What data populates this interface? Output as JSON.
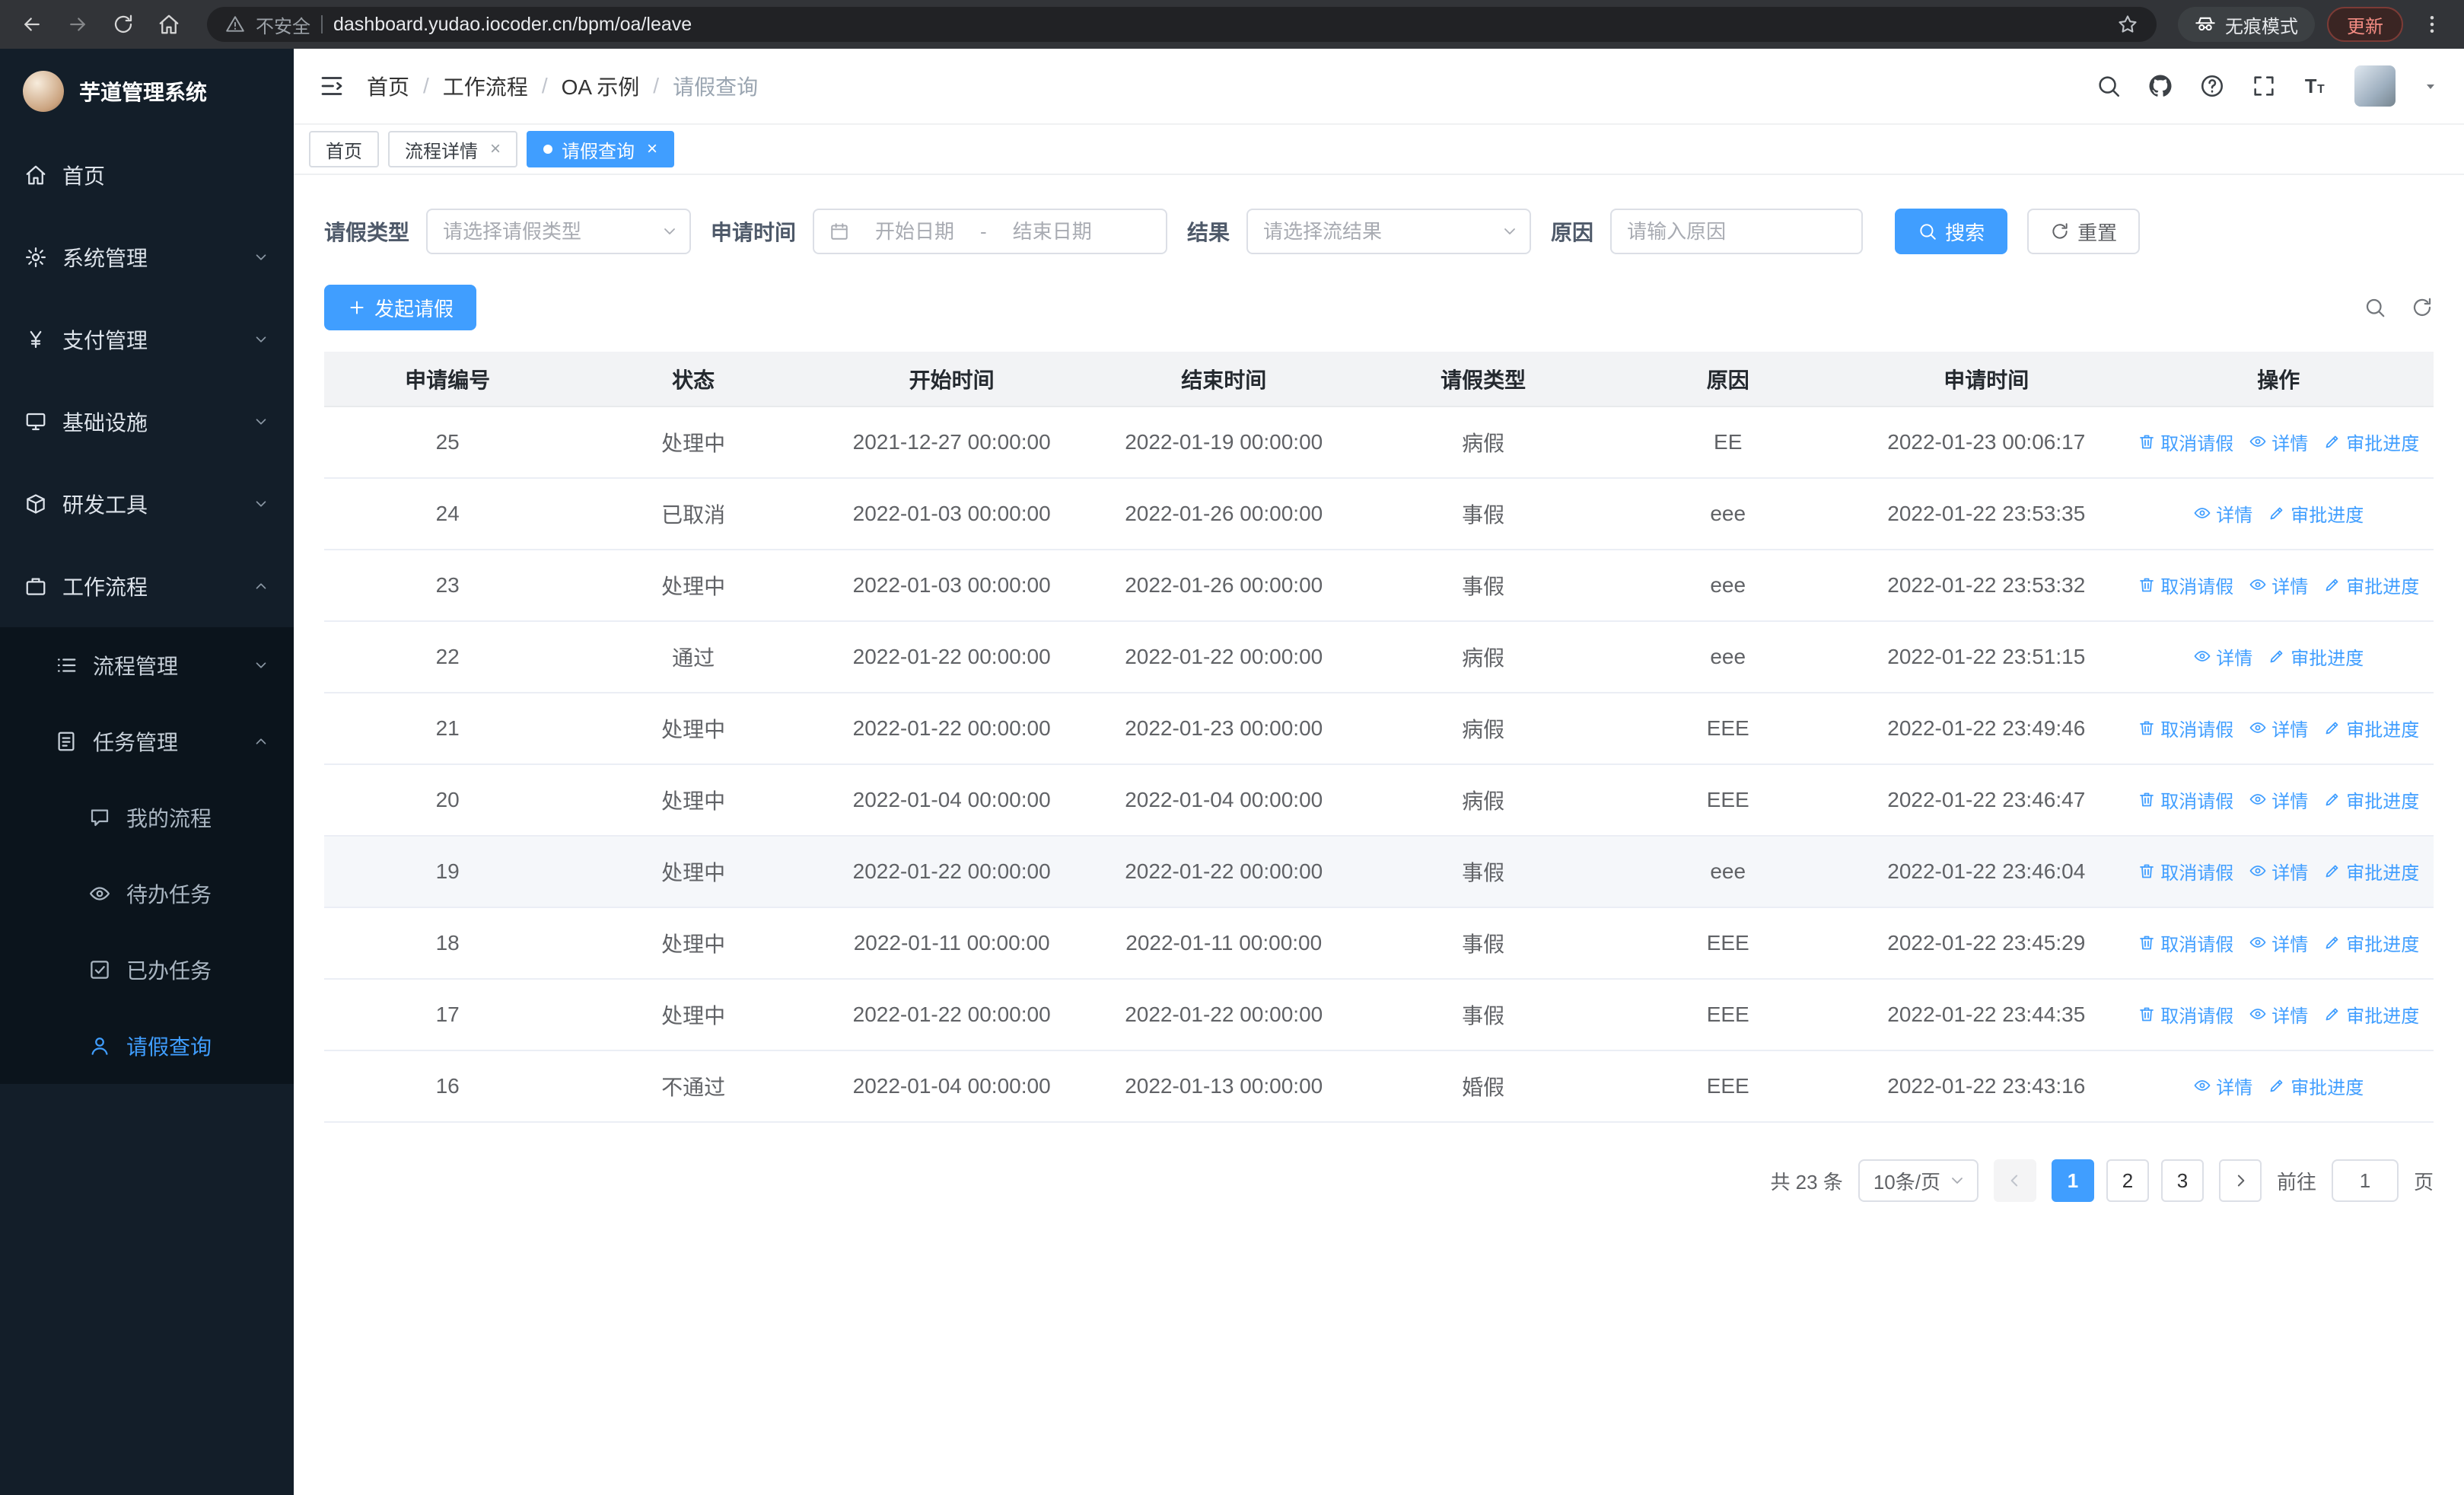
{
  "colors": {
    "primary": "#409eff",
    "sidebar_bg": "#131e29",
    "submenu_bg": "#0b141c"
  },
  "browser": {
    "security_warning": "不安全",
    "url": "dashboard.yudao.iocoder.cn/bpm/oa/leave",
    "incognito_label": "无痕模式",
    "update_button": "更新"
  },
  "sidebar": {
    "logo_title": "芋道管理系统",
    "items": [
      {
        "key": "home",
        "label": "首页",
        "icon": "home-icon",
        "level": 1
      },
      {
        "key": "system",
        "label": "系统管理",
        "icon": "gear-icon",
        "level": 1,
        "chevron": "down"
      },
      {
        "key": "payment",
        "label": "支付管理",
        "icon": "payment-icon",
        "level": 1,
        "chevron": "down"
      },
      {
        "key": "infrastructure",
        "label": "基础设施",
        "icon": "infra-icon",
        "level": 1,
        "chevron": "down"
      },
      {
        "key": "devtools",
        "label": "研发工具",
        "icon": "tools-icon",
        "level": 1,
        "chevron": "down"
      },
      {
        "key": "workflow",
        "label": "工作流程",
        "icon": "workflow-icon",
        "level": 1,
        "chevron": "up"
      }
    ],
    "submenu": [
      {
        "key": "process-management",
        "label": "流程管理",
        "icon": "process-icon",
        "level": 2,
        "chevron": "down"
      },
      {
        "key": "task-management",
        "label": "任务管理",
        "icon": "task-icon",
        "level": 2,
        "chevron": "up"
      },
      {
        "key": "my-process",
        "label": "我的流程",
        "icon": "my-process-icon",
        "level": 3
      },
      {
        "key": "todo-tasks",
        "label": "待办任务",
        "icon": "todo-icon",
        "level": 3
      },
      {
        "key": "done-tasks",
        "label": "已办任务",
        "icon": "done-icon",
        "level": 3
      },
      {
        "key": "leave-query",
        "label": "请假查询",
        "icon": "leave-icon",
        "level": 3,
        "active": true
      }
    ]
  },
  "header": {
    "breadcrumb": [
      "首页",
      "工作流程",
      "OA 示例",
      "请假查询"
    ]
  },
  "tabs": [
    {
      "label": "首页",
      "closable": false,
      "active": false
    },
    {
      "label": "流程详情",
      "closable": true,
      "active": false
    },
    {
      "label": "请假查询",
      "closable": true,
      "active": true
    }
  ],
  "filters": {
    "leave_type": {
      "label": "请假类型",
      "placeholder": "请选择请假类型"
    },
    "apply_time": {
      "label": "申请时间",
      "start_placeholder": "开始日期",
      "separator": "-",
      "end_placeholder": "结束日期"
    },
    "result": {
      "label": "结果",
      "placeholder": "请选择流结果"
    },
    "reason": {
      "label": "原因",
      "placeholder": "请输入原因"
    },
    "search_button": "搜索",
    "reset_button": "重置"
  },
  "toolbar": {
    "create_button": "发起请假"
  },
  "table": {
    "columns": [
      "申请编号",
      "状态",
      "开始时间",
      "结束时间",
      "请假类型",
      "原因",
      "申请时间",
      "操作"
    ],
    "action_labels": {
      "cancel": "取消请假",
      "detail": "详情",
      "progress": "审批进度"
    },
    "rows": [
      {
        "id": "25",
        "status": "处理中",
        "start": "2021-12-27 00:00:00",
        "end": "2022-01-19 00:00:00",
        "type": "病假",
        "reason": "EE",
        "applied": "2022-01-23 00:06:17",
        "actions": [
          "cancel",
          "detail",
          "progress"
        ]
      },
      {
        "id": "24",
        "status": "已取消",
        "start": "2022-01-03 00:00:00",
        "end": "2022-01-26 00:00:00",
        "type": "事假",
        "reason": "eee",
        "applied": "2022-01-22 23:53:35",
        "actions": [
          "detail",
          "progress"
        ]
      },
      {
        "id": "23",
        "status": "处理中",
        "start": "2022-01-03 00:00:00",
        "end": "2022-01-26 00:00:00",
        "type": "事假",
        "reason": "eee",
        "applied": "2022-01-22 23:53:32",
        "actions": [
          "cancel",
          "detail",
          "progress"
        ]
      },
      {
        "id": "22",
        "status": "通过",
        "start": "2022-01-22 00:00:00",
        "end": "2022-01-22 00:00:00",
        "type": "病假",
        "reason": "eee",
        "applied": "2022-01-22 23:51:15",
        "actions": [
          "detail",
          "progress"
        ]
      },
      {
        "id": "21",
        "status": "处理中",
        "start": "2022-01-22 00:00:00",
        "end": "2022-01-23 00:00:00",
        "type": "病假",
        "reason": "EEE",
        "applied": "2022-01-22 23:49:46",
        "actions": [
          "cancel",
          "detail",
          "progress"
        ]
      },
      {
        "id": "20",
        "status": "处理中",
        "start": "2022-01-04 00:00:00",
        "end": "2022-01-04 00:00:00",
        "type": "病假",
        "reason": "EEE",
        "applied": "2022-01-22 23:46:47",
        "actions": [
          "cancel",
          "detail",
          "progress"
        ]
      },
      {
        "id": "19",
        "status": "处理中",
        "start": "2022-01-22 00:00:00",
        "end": "2022-01-22 00:00:00",
        "type": "事假",
        "reason": "eee",
        "applied": "2022-01-22 23:46:04",
        "actions": [
          "cancel",
          "detail",
          "progress"
        ],
        "hovered": true
      },
      {
        "id": "18",
        "status": "处理中",
        "start": "2022-01-11 00:00:00",
        "end": "2022-01-11 00:00:00",
        "type": "事假",
        "reason": "EEE",
        "applied": "2022-01-22 23:45:29",
        "actions": [
          "cancel",
          "detail",
          "progress"
        ]
      },
      {
        "id": "17",
        "status": "处理中",
        "start": "2022-01-22 00:00:00",
        "end": "2022-01-22 00:00:00",
        "type": "事假",
        "reason": "EEE",
        "applied": "2022-01-22 23:44:35",
        "actions": [
          "cancel",
          "detail",
          "progress"
        ]
      },
      {
        "id": "16",
        "status": "不通过",
        "start": "2022-01-04 00:00:00",
        "end": "2022-01-13 00:00:00",
        "type": "婚假",
        "reason": "EEE",
        "applied": "2022-01-22 23:43:16",
        "actions": [
          "detail",
          "progress"
        ]
      }
    ]
  },
  "pagination": {
    "total_text": "共 23 条",
    "page_size": "10条/页",
    "pages": [
      "1",
      "2",
      "3"
    ],
    "active_page": "1",
    "jump_prefix": "前往",
    "jump_value": "1",
    "jump_suffix": "页"
  }
}
